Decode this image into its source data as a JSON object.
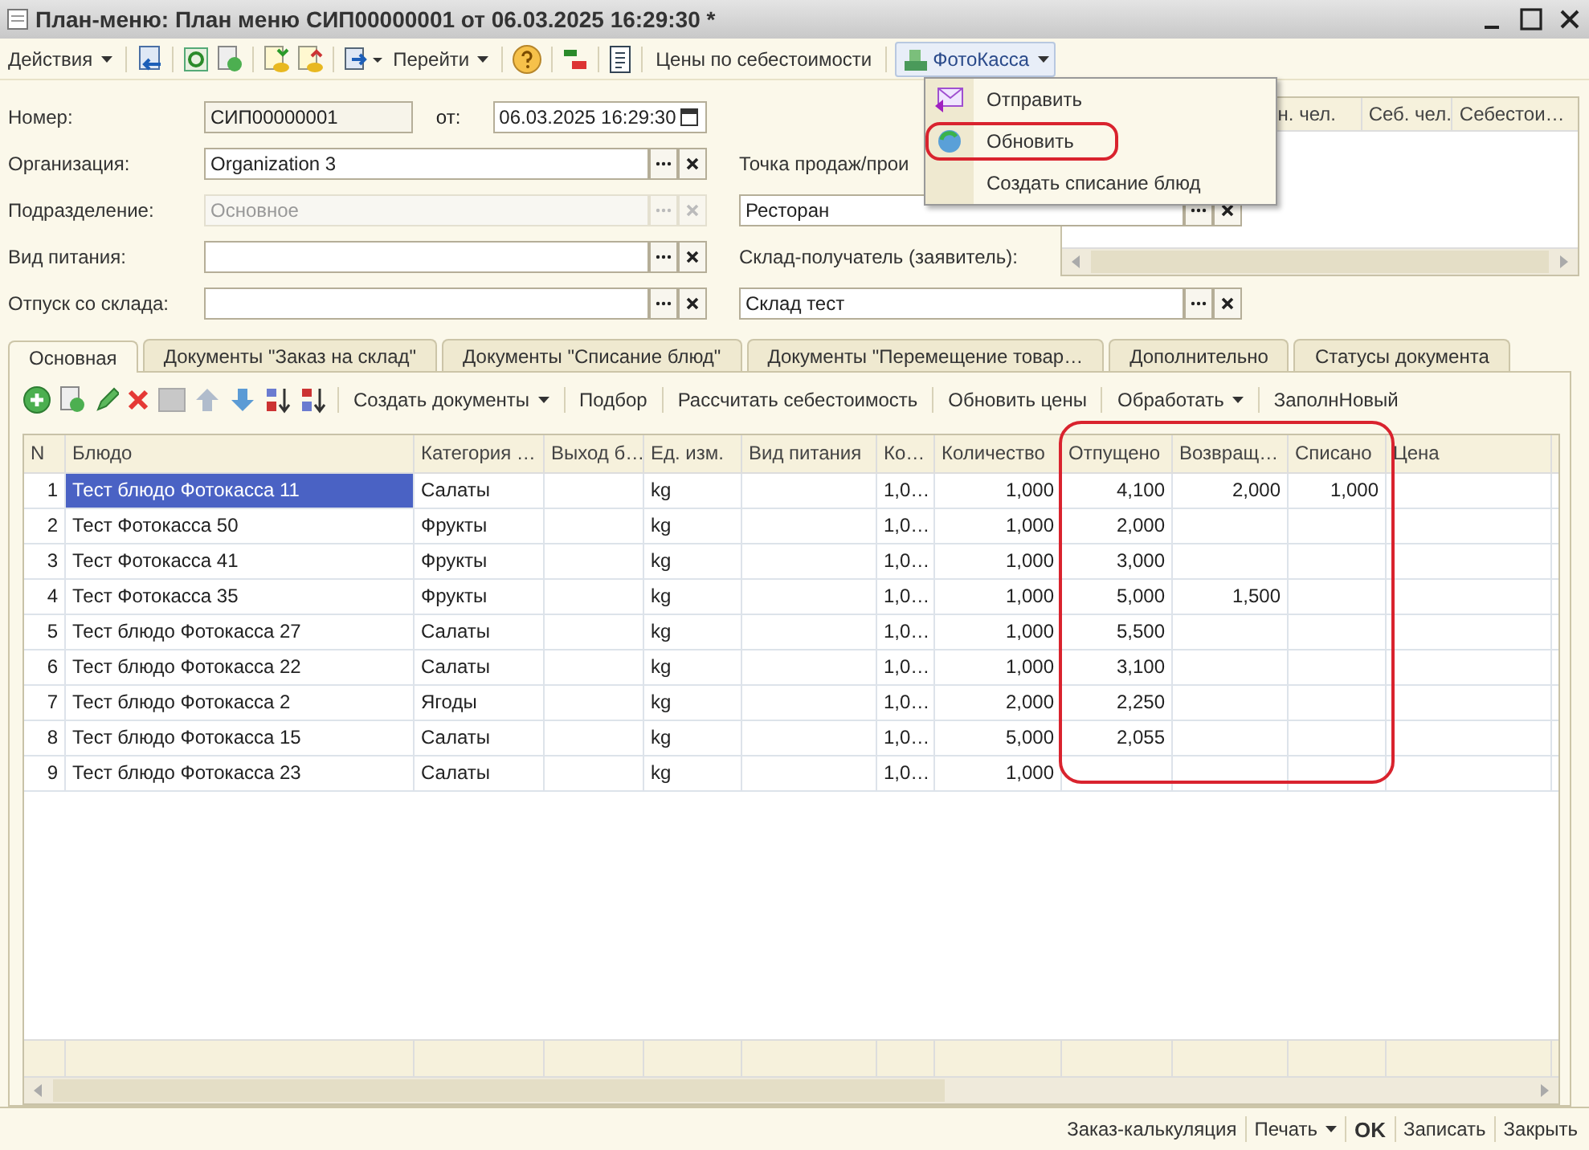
{
  "window": {
    "title": "План-меню: План меню СИП00000001 от 06.03.2025 16:29:30 *"
  },
  "toolbar": {
    "actions": "Действия",
    "goto": "Перейти",
    "cost_prices": "Цены по себестоимости",
    "photokassa": "ФотоКасса"
  },
  "photokassa_menu": [
    {
      "label": "Отправить",
      "highlighted": false
    },
    {
      "label": "Обновить",
      "highlighted": true
    },
    {
      "label": "Создать списание блюд",
      "highlighted": false
    }
  ],
  "form": {
    "number": {
      "label": "Номер:",
      "value": "СИП00000001"
    },
    "date": {
      "label": "от:",
      "value": "06.03.2025 16:29:30"
    },
    "fields": [
      {
        "label": "Организация:",
        "value": "Organization 3",
        "disabled": false
      },
      {
        "label": "Подразделение:",
        "value": "Основное",
        "disabled": true
      },
      {
        "label": "Вид питания:",
        "disabled": false
      },
      {
        "label": "Отпуск со склада:",
        "disabled": false
      }
    ],
    "right_fields": [
      {
        "label": "Точка продаж/прои",
        "value": "Ресторан"
      },
      {
        "label": "Склад-получатель (заявитель):",
        "value": "Склад тест"
      }
    ],
    "side_table": {
      "columns": [
        "н. чел.",
        "Себ. чел.",
        "Себестои…"
      ]
    }
  },
  "tabs": [
    {
      "label": "Основная",
      "selected": true
    },
    {
      "label": "Документы \"Заказ на склад\"",
      "selected": false
    },
    {
      "label": "Документы \"Списание блюд\"",
      "selected": false
    },
    {
      "label": "Документы \"Перемещение товар…",
      "selected": false
    },
    {
      "label": "Дополнительно",
      "selected": false
    },
    {
      "label": "Статусы документа",
      "selected": false
    }
  ],
  "tab_toolbar": [
    {
      "label": "Создать документы",
      "menu": true
    },
    {
      "label": "Подбор",
      "menu": false
    },
    {
      "label": "Рассчитать себестоимость",
      "menu": false
    },
    {
      "label": "Обновить цены",
      "menu": false
    },
    {
      "label": "Обработать",
      "menu": true
    },
    {
      "label": "ЗаполнНовый",
      "menu": false
    }
  ],
  "table": {
    "columns": [
      "N",
      "Блюдо",
      "Категория …",
      "Выход б…",
      "Ед. изм.",
      "Вид питания",
      "Ко…",
      "Количество",
      "Отпущено",
      "Возвращ…",
      "Списано",
      "Цена"
    ],
    "rows": [
      {
        "n": "1",
        "dish": "Тест блюдо Фотокасса 11",
        "category": "Салаты",
        "unit": "kg",
        "coef": "1,0…",
        "qty": "1,000",
        "issued": "4,100",
        "returned": "2,000",
        "written_off": "1,000",
        "selected": true
      },
      {
        "n": "2",
        "dish": "Тест Фотокасса 50",
        "category": "Фрукты",
        "unit": "kg",
        "coef": "1,0…",
        "qty": "1,000",
        "issued": "2,000",
        "selected": false
      },
      {
        "n": "3",
        "dish": "Тест Фотокасса 41",
        "category": "Фрукты",
        "unit": "kg",
        "coef": "1,0…",
        "qty": "1,000",
        "issued": "3,000",
        "selected": false
      },
      {
        "n": "4",
        "dish": "Тест Фотокасса 35",
        "category": "Фрукты",
        "unit": "kg",
        "coef": "1,0…",
        "qty": "1,000",
        "issued": "5,000",
        "returned": "1,500",
        "selected": false
      },
      {
        "n": "5",
        "dish": "Тест блюдо Фотокасса 27",
        "category": "Салаты",
        "unit": "kg",
        "coef": "1,0…",
        "qty": "1,000",
        "issued": "5,500",
        "selected": false
      },
      {
        "n": "6",
        "dish": "Тест блюдо Фотокасса 22",
        "category": "Салаты",
        "unit": "kg",
        "coef": "1,0…",
        "qty": "1,000",
        "issued": "3,100",
        "selected": false
      },
      {
        "n": "7",
        "dish": "Тест блюдо Фотокасса 2",
        "category": "Ягоды",
        "unit": "kg",
        "coef": "1,0…",
        "qty": "2,000",
        "issued": "2,250",
        "selected": false
      },
      {
        "n": "8",
        "dish": "Тест блюдо Фотокасса 15",
        "category": "Салаты",
        "unit": "kg",
        "coef": "1,0…",
        "qty": "5,000",
        "issued": "2,055",
        "selected": false
      },
      {
        "n": "9",
        "dish": "Тест блюдо Фотокасса 23",
        "category": "Салаты",
        "unit": "kg",
        "coef": "1,0…",
        "qty": "1,000",
        "selected": false
      }
    ]
  },
  "footer": [
    {
      "label": "Заказ-калькуляция",
      "kind": "plain"
    },
    {
      "label": "Печать",
      "kind": "menu"
    },
    {
      "label": "OK",
      "kind": "default"
    },
    {
      "label": "Записать",
      "kind": "plain"
    },
    {
      "label": "Закрыть",
      "kind": "plain"
    }
  ]
}
